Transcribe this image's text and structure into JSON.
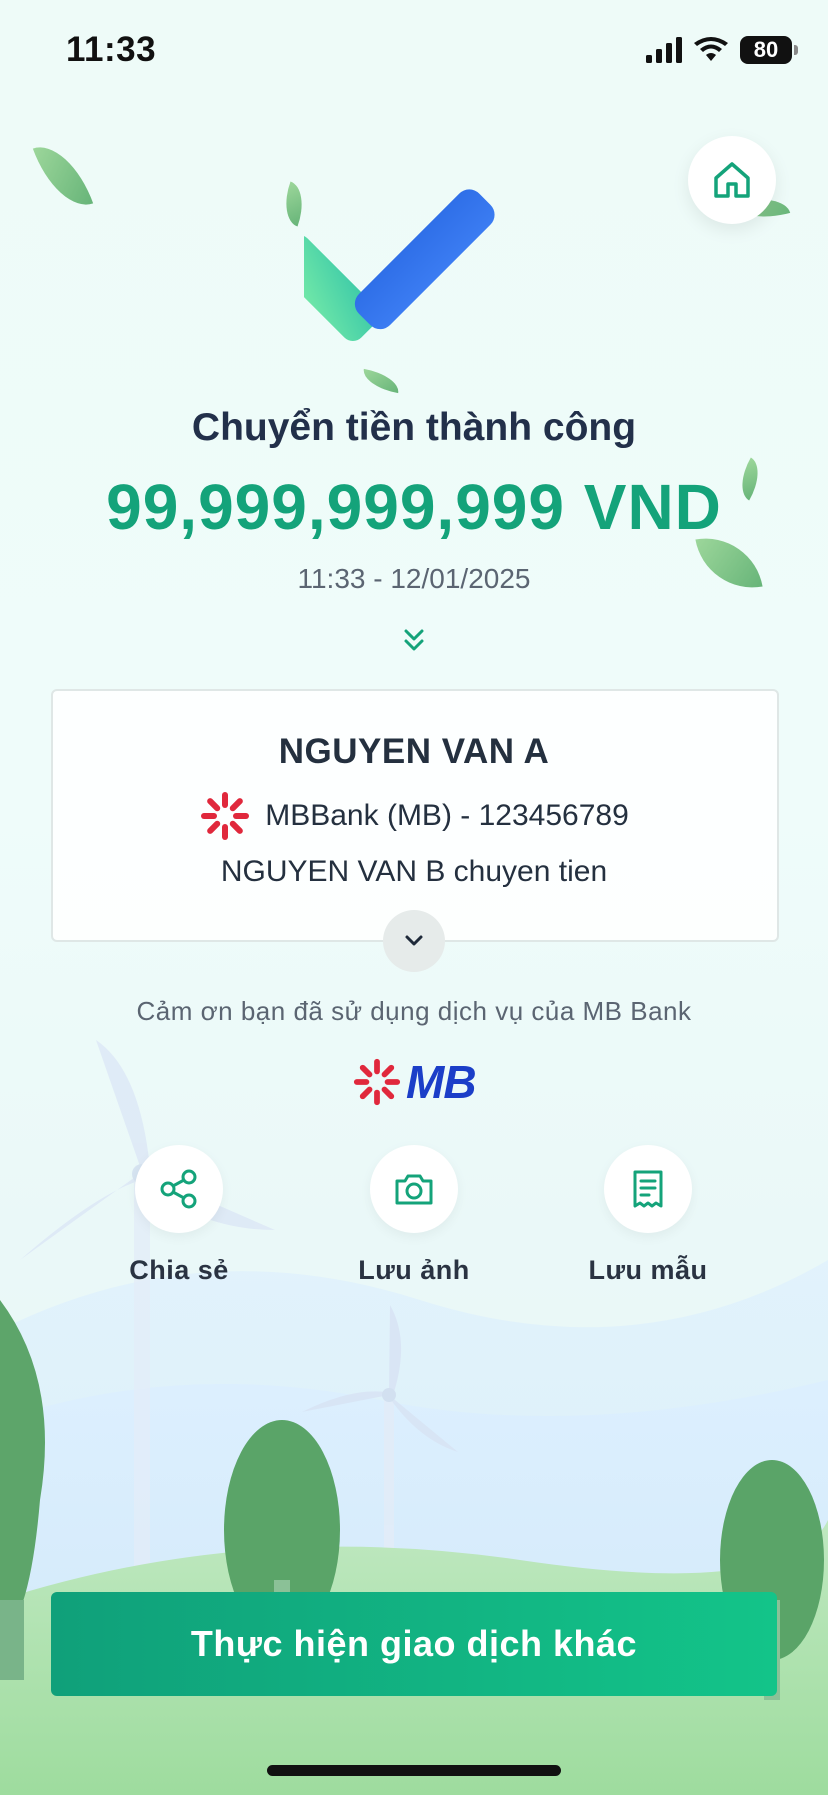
{
  "status_bar": {
    "time": "11:33",
    "battery": "80"
  },
  "result": {
    "title": "Chuyển tiền thành công",
    "amount": "99,999,999,999 VND",
    "datetime": "11:33 - 12/01/2025"
  },
  "transfer_card": {
    "recipient_name": "NGUYEN VAN A",
    "bank_account": "MBBank (MB) - 123456789",
    "memo": "NGUYEN VAN B chuyen tien"
  },
  "thanks_text": "Cảm ơn bạn đã sử dụng dịch vụ của MB Bank",
  "brand": {
    "logo_text": "MB",
    "primary_color": "#14a37a",
    "logo_blue": "#1b3ec8",
    "logo_red": "#e0283c"
  },
  "actions": [
    {
      "label": "Chia sẻ",
      "icon": "share-icon"
    },
    {
      "label": "Lưu ảnh",
      "icon": "camera-icon"
    },
    {
      "label": "Lưu mẫu",
      "icon": "receipt-icon"
    }
  ],
  "cta_label": "Thực hiện giao dịch khác"
}
